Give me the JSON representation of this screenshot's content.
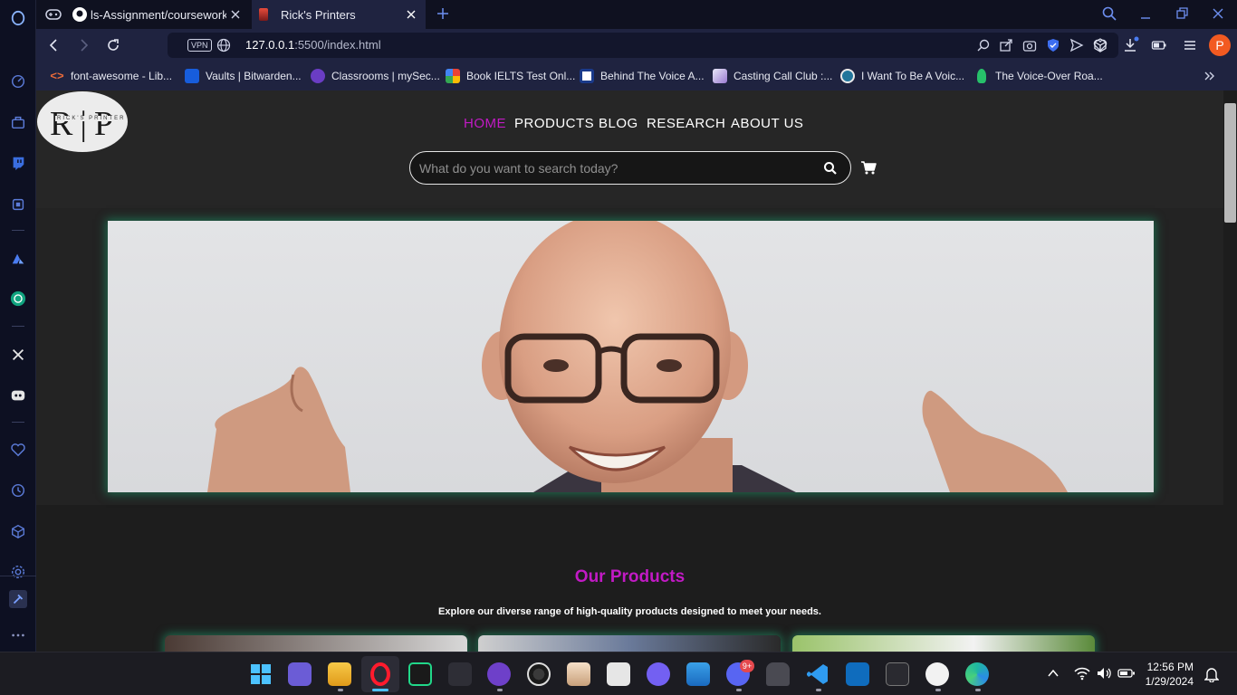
{
  "browser": {
    "tabs": [
      {
        "title": "ls-Assignment/coursework",
        "active": false
      },
      {
        "title": "Rick's Printers",
        "active": true
      }
    ],
    "address": {
      "vpn_label": "VPN",
      "url_host": "127.0.0.1",
      "url_rest": ":5500/index.html"
    },
    "profile_initial": "P",
    "bookmarks": [
      {
        "label": "font-awesome - Lib...",
        "icon": "code-icon"
      },
      {
        "label": "Vaults | Bitwarden...",
        "icon": "bitwarden-icon"
      },
      {
        "label": "Classrooms | mySec...",
        "icon": "classroom-icon"
      },
      {
        "label": "Book IELTS Test Onl...",
        "icon": "ielts-icon"
      },
      {
        "label": "Behind The Voice A...",
        "icon": "behind-voice-icon"
      },
      {
        "label": "Casting Call Club :...",
        "icon": "casting-call-icon"
      },
      {
        "label": "I Want To Be A Voic...",
        "icon": "wordpress-icon"
      },
      {
        "label": "The Voice-Over Roa...",
        "icon": "lightbulb-icon"
      }
    ]
  },
  "site": {
    "logo": {
      "mark": "R|P",
      "subtitle": "RICK'S PRINTER"
    },
    "nav": [
      "HOME",
      "PRODUCTS",
      "BLOG",
      "RESEARCH",
      "ABOUT US"
    ],
    "active_nav": "HOME",
    "search": {
      "placeholder": "What do you want to search today?"
    },
    "hero_alt": "Smiling elderly man with glasses giving thumbs up",
    "products": {
      "title": "Our Products",
      "subtitle": "Explore our diverse range of high-quality products designed to meet your needs."
    },
    "colors": {
      "accent": "#c21ac5",
      "glow": "#1f6b4e",
      "background": "#1d1d1d"
    }
  },
  "taskbar": {
    "time": "12:56 PM",
    "date": "1/29/2024",
    "discord_badge": "9+"
  }
}
